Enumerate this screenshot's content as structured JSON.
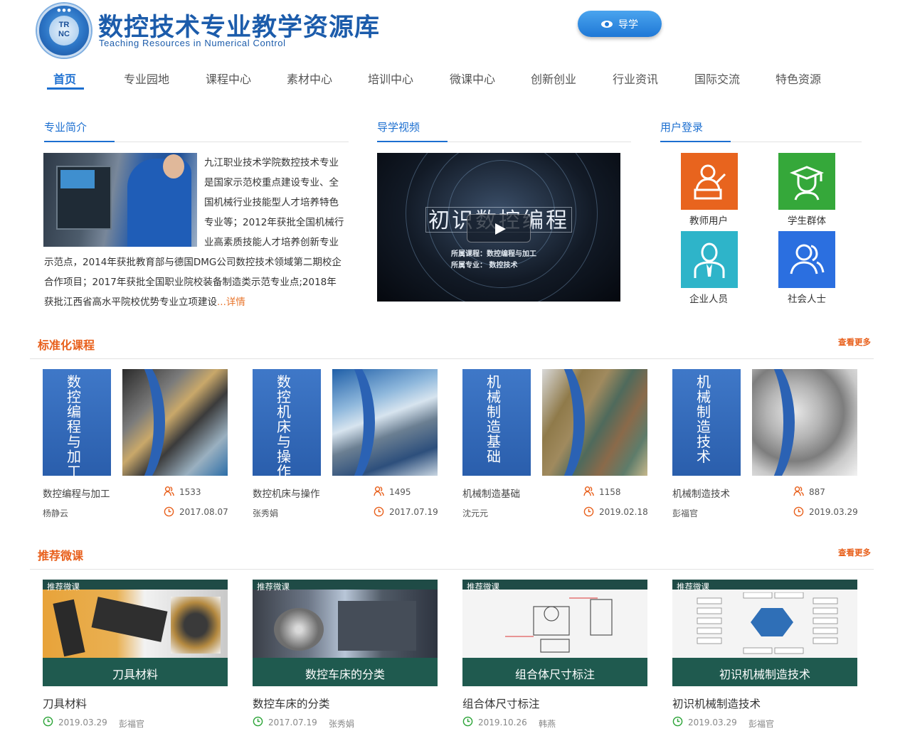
{
  "header": {
    "logo_text": "TR\nNC",
    "title": "数控技术专业教学资源库",
    "subtitle": "Teaching Resources in Numerical Control",
    "guide_button": "导学"
  },
  "nav": {
    "items": [
      "首页",
      "专业园地",
      "课程中心",
      "素材中心",
      "培训中心",
      "微课中心",
      "创新创业",
      "行业资讯",
      "国际交流",
      "特色资源"
    ],
    "active": "首页"
  },
  "intro": {
    "heading": "专业简介",
    "lines": [
      "九江职业技术学院数控技术专业",
      "是国家示范校重点建设专业、全",
      "国机械行业技能型人才培养特色",
      "专业等；2012年获批全国机械行",
      "业高素质技能人才培养创新专业",
      "示范点，2014年获批教育部与德国DMG公司数控技术领域第二期校企",
      "合作项目；2017年获批全国职业院校装备制造类示范专业点;2018年",
      "获批江西省高水平院校优势专业立项建设"
    ],
    "more_link": "...详情"
  },
  "video": {
    "heading": "导学视频",
    "title": "初识数控编程",
    "caption_course": "所属课程：数控编程与加工",
    "caption_major": "所属专业：  数控技术"
  },
  "login": {
    "heading": "用户登录",
    "tiles": [
      {
        "label": "教师用户",
        "color": "#e8641e",
        "icon": "teacher-icon"
      },
      {
        "label": "学生群体",
        "color": "#35a83a",
        "icon": "student-icon"
      },
      {
        "label": "企业人员",
        "color": "#2eb4c9",
        "icon": "employee-icon"
      },
      {
        "label": "社会人士",
        "color": "#2b6fe0",
        "icon": "people-icon"
      }
    ]
  },
  "standard_courses": {
    "heading": "标准化课程",
    "see_more": "查看更多",
    "items": [
      {
        "vertical": "数控编程与加工",
        "name": "数控编程与加工",
        "teacher": "杨静云",
        "views": "1533",
        "date": "2017.08.07"
      },
      {
        "vertical": "数控机床与操作",
        "name": "数控机床与操作",
        "teacher": "张秀娟",
        "views": "1495",
        "date": "2017.07.19"
      },
      {
        "vertical": "机械制造基础",
        "name": "机械制造基础",
        "teacher": "沈元元",
        "views": "1158",
        "date": "2019.02.18"
      },
      {
        "vertical": "机械制造技术",
        "name": "机械制造技术",
        "teacher": "彭福官",
        "views": "887",
        "date": "2019.03.29"
      }
    ]
  },
  "micro_courses": {
    "heading": "推荐微课",
    "see_more": "查看更多",
    "tag": "推荐微课",
    "items": [
      {
        "caption": "刀具材料",
        "name": "刀具材料",
        "date": "2019.03.29",
        "teacher": "彭福官"
      },
      {
        "caption": "数控车床的分类",
        "name": "数控车床的分类",
        "date": "2017.07.19",
        "teacher": "张秀娟"
      },
      {
        "caption": "组合体尺寸标注",
        "name": "组合体尺寸标注",
        "date": "2019.10.26",
        "teacher": "韩燕"
      },
      {
        "caption": "初识机械制造技术",
        "name": "初识机械制造技术",
        "date": "2019.03.29",
        "teacher": "彭福官"
      }
    ]
  },
  "colors": {
    "brand_blue": "#1c6fd0",
    "accent_orange": "#e8601c"
  }
}
